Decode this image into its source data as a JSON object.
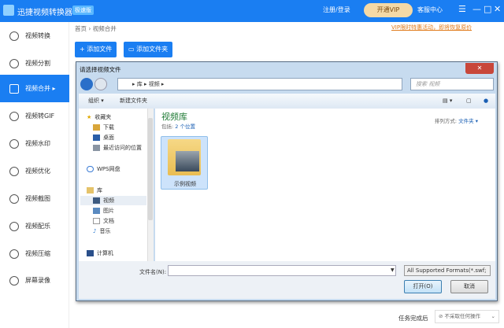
{
  "app": {
    "name": "迅捷视频转换器",
    "edition": "极速版",
    "login": "注册/登录",
    "vip": "开通VIP",
    "service": "客服中心",
    "menu": "☰",
    "minimize": "—",
    "maximize": "□",
    "close": "✕"
  },
  "sidebar": {
    "items": [
      {
        "label": "视频转换"
      },
      {
        "label": "视频分割"
      },
      {
        "label": "视频合并",
        "active": true
      },
      {
        "label": "视频转GIF"
      },
      {
        "label": "视频水印"
      },
      {
        "label": "视频优化"
      },
      {
        "label": "视频截图"
      },
      {
        "label": "视频配乐"
      },
      {
        "label": "视频压缩"
      },
      {
        "label": "屏幕录像"
      }
    ]
  },
  "main": {
    "breadcrumb": "首页 › 视频合并",
    "promo": "VIP限时特惠活动，即将恢复原价",
    "add_file": "+ 添加文件",
    "add_folder": "▭ 添加文件夹"
  },
  "dialog": {
    "title": "请选择视频文件",
    "close": "✕",
    "address": "▸ 库 ▸ 视频 ▸",
    "search_placeholder": "搜索 视频",
    "organize": "组织 ▾",
    "new_folder": "新建文件夹",
    "nav": [
      {
        "label": "收藏夹",
        "icon": "star-icon"
      },
      {
        "label": "下载",
        "icon": "download-icon"
      },
      {
        "label": "桌面",
        "icon": "desktop-icon"
      },
      {
        "label": "最近访问的位置",
        "icon": "recent-icon"
      },
      {
        "label": "WPS网盘",
        "icon": "cloud-icon"
      },
      {
        "label": "库",
        "icon": "library-icon"
      },
      {
        "label": "视频",
        "icon": "video-icon",
        "selected": true
      },
      {
        "label": "图片",
        "icon": "picture-icon"
      },
      {
        "label": "文档",
        "icon": "document-icon"
      },
      {
        "label": "音乐",
        "icon": "music-icon"
      },
      {
        "label": "计算机",
        "icon": "computer-icon"
      }
    ],
    "library_title": "视频库",
    "library_sub_prefix": "包括:",
    "library_sub_link": "2 个位置",
    "sort_label": "排列方式:",
    "sort_value": "文件夹 ▾",
    "items": [
      {
        "name": "示例视频"
      }
    ],
    "filename_label": "文件名(N):",
    "filename_value": "",
    "filter": "All Supported Formats(*.swf;",
    "open": "打开(O)",
    "cancel": "取消"
  },
  "status": {
    "after_task_label": "任务完成后",
    "after_task_value": "⊘ 不采取任何操作"
  }
}
